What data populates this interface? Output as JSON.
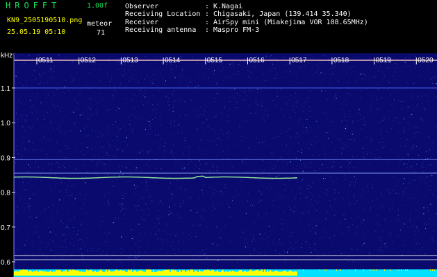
{
  "header": {
    "title": "HROFFT",
    "version": "1.00f",
    "filename": "KN9_2505190510.png",
    "datetime": "25.05.19 05:10",
    "mode": "meteor",
    "count": "71"
  },
  "info": [
    {
      "label": "Observer",
      "value": "K.Nagai"
    },
    {
      "label": "Receiving Location",
      "value": "Chigasaki, Japan (139.414 35.340)"
    },
    {
      "label": "Receiver",
      "value": "AirSpy mini (Miakejima VOR 108.65MHz)"
    },
    {
      "label": "Receiving antenna",
      "value": "Maspro FM-3"
    }
  ],
  "axis": {
    "unit": "kHz",
    "y_ticks": [
      "1.1",
      "1.0",
      "0.9",
      "0.8",
      "0.7",
      "0.6"
    ],
    "y_values": [
      1.1,
      1.0,
      0.9,
      0.8,
      0.7,
      0.6
    ],
    "ymin": 0.6,
    "ymax": 1.2,
    "x_ticks": [
      "0511",
      "0512",
      "0513",
      "0514",
      "0515",
      "0516",
      "0517",
      "0518",
      "0519",
      "0520"
    ]
  },
  "colors": {
    "background": "#0a0a6e",
    "label_green": "#19e05a",
    "label_yellow": "#ffff00",
    "trace": "#a0ffa0",
    "time_marker": "#ffc8c8",
    "bottom_yellow": "#ffff00",
    "bottom_cyan": "#00e0ff"
  }
}
